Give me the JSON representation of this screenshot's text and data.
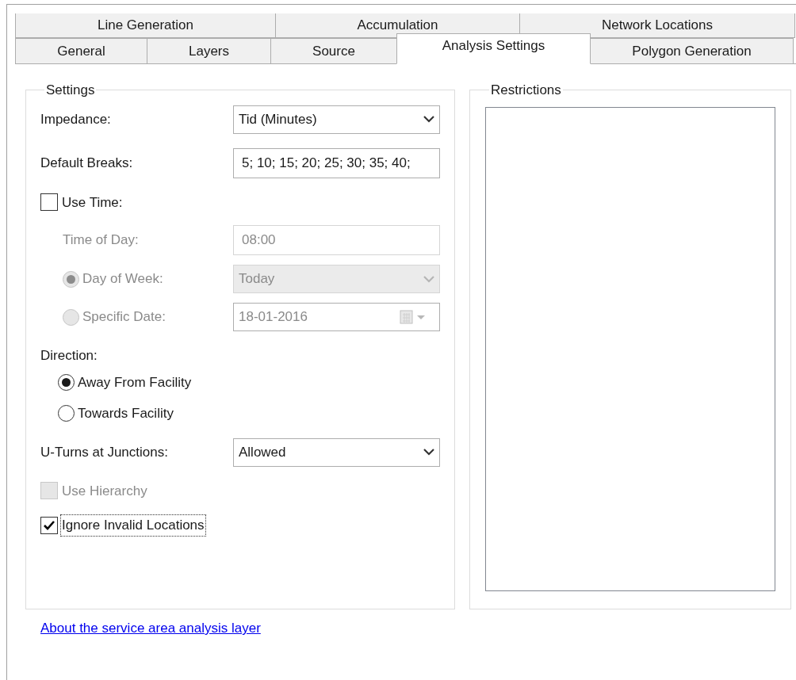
{
  "tabs": [
    [
      {
        "label": "Line Generation",
        "selected": false
      },
      {
        "label": "Accumulation",
        "selected": false
      },
      {
        "label": "Network Locations",
        "selected": false
      }
    ],
    [
      {
        "label": "General",
        "selected": false
      },
      {
        "label": "Layers",
        "selected": false
      },
      {
        "label": "Source",
        "selected": false
      },
      {
        "label": "Analysis Settings",
        "selected": true
      },
      {
        "label": "Polygon Generation",
        "selected": false
      }
    ]
  ],
  "settings": {
    "title": "Settings",
    "items": [
      {
        "kind": "select",
        "label": "Impedance:",
        "value": "Tid (Minutes)",
        "disabled": false
      },
      {
        "kind": "text",
        "label": "Default Breaks:",
        "value": "5; 10; 15; 20; 25; 30; 35; 40;",
        "disabled": false
      },
      {
        "kind": "checkbox",
        "label": "Use Time:",
        "checked": false,
        "disabled": false,
        "focused": false,
        "children": [
          {
            "kind": "text",
            "label": "Time of Day:",
            "value": "08:00",
            "disabled": true
          },
          {
            "kind": "radio_select",
            "label": "Day of Week:",
            "selected": true,
            "value": "Today",
            "disabled": true
          },
          {
            "kind": "radio_date",
            "label": "Specific Date:",
            "selected": false,
            "value": "18-01-2016",
            "disabled": true
          }
        ]
      },
      {
        "kind": "heading",
        "label": "Direction:",
        "children": [
          {
            "kind": "radio",
            "label": "Away From Facility",
            "selected": true,
            "disabled": false
          },
          {
            "kind": "radio",
            "label": "Towards Facility",
            "selected": false,
            "disabled": false
          }
        ]
      },
      {
        "kind": "select",
        "label": "U-Turns at Junctions:",
        "value": "Allowed",
        "disabled": false
      },
      {
        "kind": "checkbox",
        "label": "Use Hierarchy",
        "checked": false,
        "disabled": true,
        "focused": false
      },
      {
        "kind": "checkbox",
        "label": "Ignore Invalid Locations",
        "checked": true,
        "disabled": false,
        "focused": true
      }
    ]
  },
  "restrictions": {
    "title": "Restrictions"
  },
  "link": "About the service area analysis layer"
}
